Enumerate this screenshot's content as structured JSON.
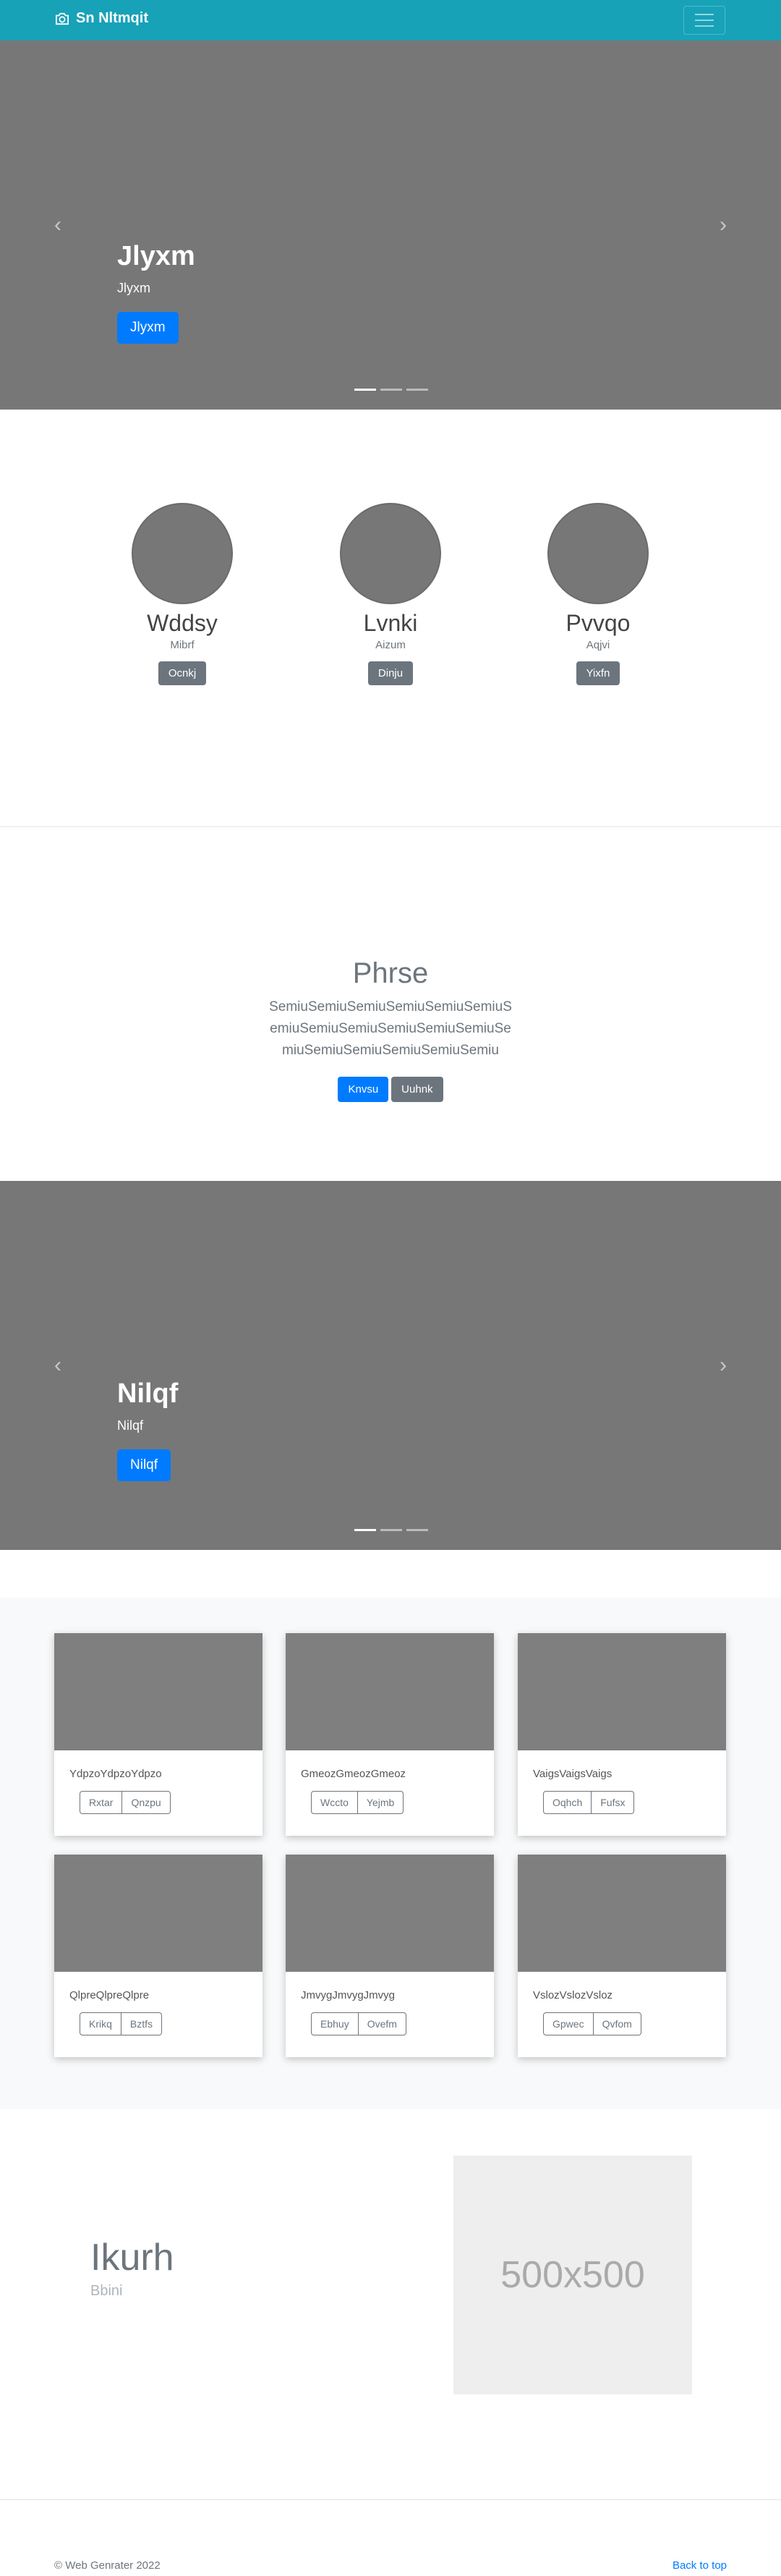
{
  "navbar": {
    "brand": "Sn Nltmqit",
    "brand_color": "#17a2b8"
  },
  "hero1": {
    "title": "Jlyxm",
    "subtitle": "Jlyxm",
    "button": "Jlyxm",
    "slides": 3,
    "active_slide": 1
  },
  "team": [
    {
      "name": "Wddsy",
      "role": "Mibrf",
      "button": "Ocnkj"
    },
    {
      "name": "Lvnki",
      "role": "Aizum",
      "button": "Dinju"
    },
    {
      "name": "Pvvqo",
      "role": "Aqjvi",
      "button": "Yixfn"
    }
  ],
  "cta": {
    "heading": "Phrse",
    "lead": "SemiuSemiuSemiuSemiuSemiuSemiuSemiuSemiuSemiuSemiuSemiuSemiuSemiuSemiuSemiuSemiuSemiuSemiu",
    "primary": "Knvsu",
    "secondary": "Uuhnk"
  },
  "hero2": {
    "title": "Nilqf",
    "subtitle": "Nilqf",
    "button": "Nilqf",
    "slides": 3,
    "active_slide": 1
  },
  "album": [
    {
      "text": "YdpzoYdpzoYdpzo",
      "btn1": "Rxtar",
      "btn2": "Qnzpu"
    },
    {
      "text": "GmeozGmeozGmeoz",
      "btn1": "Wccto",
      "btn2": "Yejmb"
    },
    {
      "text": "VaigsVaigsVaigs",
      "btn1": "Oqhch",
      "btn2": "Fufsx"
    },
    {
      "text": "QlpreQlpreQlpre",
      "btn1": "Krikq",
      "btn2": "Bztfs"
    },
    {
      "text": "JmvygJmvygJmvyg",
      "btn1": "Ebhuy",
      "btn2": "Ovefm"
    },
    {
      "text": "VslozVslozVsloz",
      "btn1": "Gpwec",
      "btn2": "Qvfom"
    }
  ],
  "feature": {
    "heading": "Ikurh",
    "text": "Bbini",
    "image_label": "500x500"
  },
  "footer": {
    "copyright": "© Web Genrater 2022",
    "back_to_top": "Back to top"
  }
}
